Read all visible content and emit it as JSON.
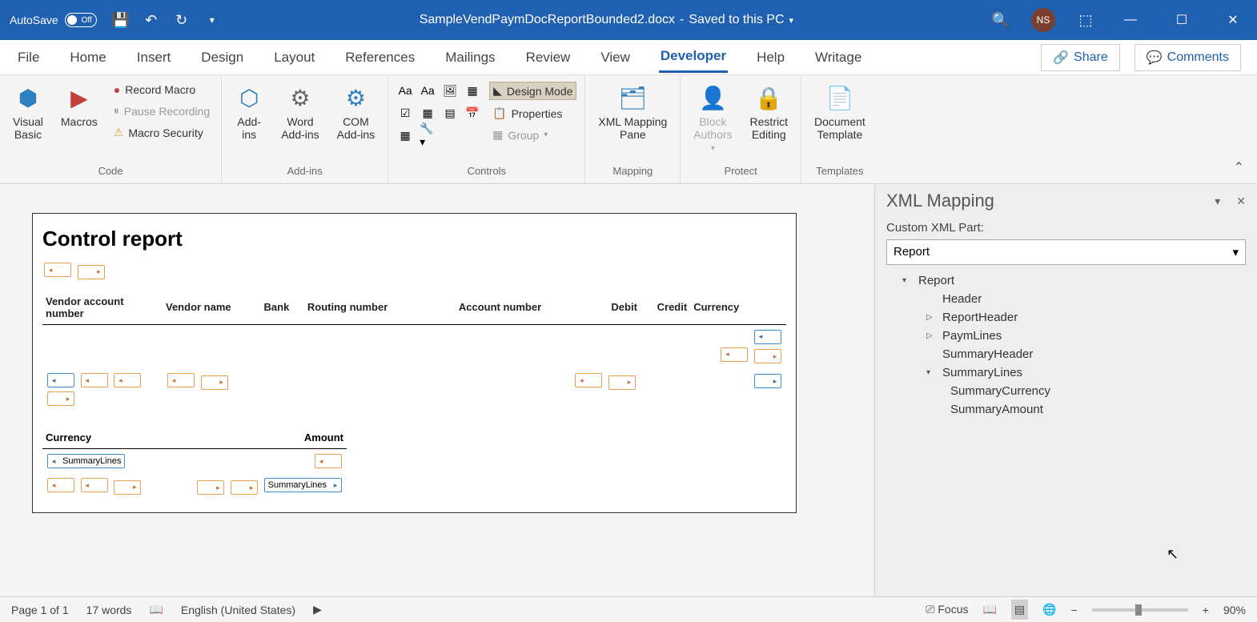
{
  "titlebar": {
    "autosave_label": "AutoSave",
    "autosave_state": "Off",
    "doc_name": "SampleVendPaymDocReportBounded2.docx",
    "save_state": "Saved to this PC",
    "avatar_initials": "NS"
  },
  "tabs": {
    "items": [
      "File",
      "Home",
      "Insert",
      "Design",
      "Layout",
      "References",
      "Mailings",
      "Review",
      "View",
      "Developer",
      "Help",
      "Writage"
    ],
    "active": "Developer",
    "share": "Share",
    "comments": "Comments"
  },
  "ribbon": {
    "code": {
      "visual_basic": "Visual\nBasic",
      "macros": "Macros",
      "record_macro": "Record Macro",
      "pause_recording": "Pause Recording",
      "macro_security": "Macro Security",
      "label": "Code"
    },
    "addins": {
      "addins": "Add-\nins",
      "word_addins": "Word\nAdd-ins",
      "com_addins": "COM\nAdd-ins",
      "label": "Add-ins"
    },
    "controls": {
      "design_mode": "Design Mode",
      "properties": "Properties",
      "group": "Group",
      "label": "Controls"
    },
    "mapping": {
      "xml_mapping": "XML Mapping\nPane",
      "label": "Mapping"
    },
    "protect": {
      "block_authors": "Block\nAuthors",
      "restrict_editing": "Restrict\nEditing",
      "label": "Protect"
    },
    "templates": {
      "doc_template": "Document\nTemplate",
      "label": "Templates"
    }
  },
  "document": {
    "heading": "Control report",
    "table_headers": [
      "Vendor account number",
      "Vendor name",
      "Bank",
      "Routing number",
      "Account number",
      "Debit",
      "Credit",
      "Currency"
    ],
    "summary_headers": [
      "Currency",
      "Amount"
    ],
    "cc_summary_lines": "SummaryLines"
  },
  "xml_pane": {
    "title": "XML Mapping",
    "label": "Custom XML Part:",
    "selected": "Report",
    "tree": {
      "root": "Report",
      "items": [
        "Header",
        "ReportHeader",
        "PaymLines",
        "SummaryHeader",
        "SummaryLines"
      ],
      "summary_children": [
        "SummaryCurrency",
        "SummaryAmount"
      ]
    }
  },
  "statusbar": {
    "page": "Page 1 of 1",
    "words": "17 words",
    "language": "English (United States)",
    "focus": "Focus",
    "zoom": "90%"
  }
}
